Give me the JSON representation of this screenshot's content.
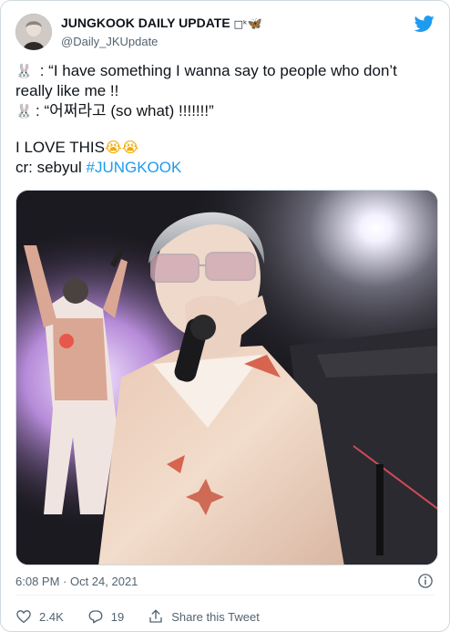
{
  "author": {
    "name": "JUNGKOOK DAILY UPDATE",
    "name_emoji_box": "□ᵏ",
    "name_emoji_butterfly": "🦋",
    "handle": "@Daily_JKUpdate"
  },
  "icons": {
    "platform": "twitter-bird-icon",
    "rabbit": "rabbit-face-icon",
    "crying": "loudly-crying-face-icon",
    "info": "info-icon",
    "like": "heart-icon",
    "reply": "reply-bubble-icon",
    "share": "share-upload-icon"
  },
  "tweet": {
    "line1_rabbit": "🐰",
    "line1_text": " : “I  have something I wanna say to people who don’t",
    "line2_text": "really like me !!",
    "line3_rabbit": "🐰",
    "line3_text": ": “어쩌라고 (so what) !!!!!!!”",
    "love_text": "I LOVE THIS",
    "love_emoji": "😭😭",
    "credit_prefix": "cr: sebyul ",
    "hashtag": "#JUNGKOOK"
  },
  "meta": {
    "timestamp": "6:08 PM · Oct 24, 2021"
  },
  "actions": {
    "likes": "2.4K",
    "replies": "19",
    "share_label": "Share this Tweet"
  },
  "colors": {
    "accent": "#1d9bf0",
    "secondary_text": "#536471",
    "border": "#cfd9de"
  }
}
